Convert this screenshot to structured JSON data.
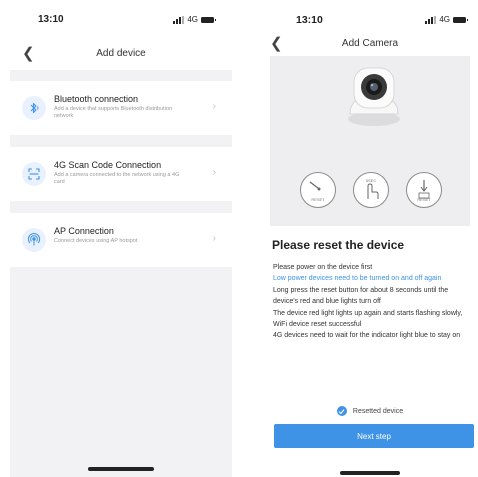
{
  "left": {
    "status": {
      "time": "13:10",
      "network": "4G"
    },
    "nav": {
      "title": "Add device"
    },
    "options": [
      {
        "title": "Bluetooth connection",
        "desc": "Add a device that supports Bluetooth distribution network"
      },
      {
        "title": "4G Scan Code Connection",
        "desc": "Add a camera connected to the network using a 4G card"
      },
      {
        "title": "AP Connection",
        "desc": "Connect devices using AP hotspot"
      }
    ]
  },
  "right": {
    "status": {
      "time": "13:10",
      "network": "4G"
    },
    "nav": {
      "title": "Add Camera"
    },
    "illustration": {
      "step1_label": "RESET",
      "step2_label": "5SEC",
      "step3_label": "RESET"
    },
    "heading": "Please reset the device",
    "instructions": {
      "line1": "Please power on the device first",
      "line2": "Low power devices need to be turned on and off again",
      "line3": "Long press the reset button for about 8 seconds until the device's red and blue lights turn off",
      "line4": "The device red light lights up again and starts flashing slowly, WiFi device reset successful",
      "line5": "4G devices need to wait for the indicator light blue to stay on"
    },
    "checkbox": {
      "label": "Resetted device",
      "checked": true
    },
    "next_label": "Next step"
  },
  "colors": {
    "accent": "#3f93e7",
    "background_gray": "#f2f2f4"
  }
}
